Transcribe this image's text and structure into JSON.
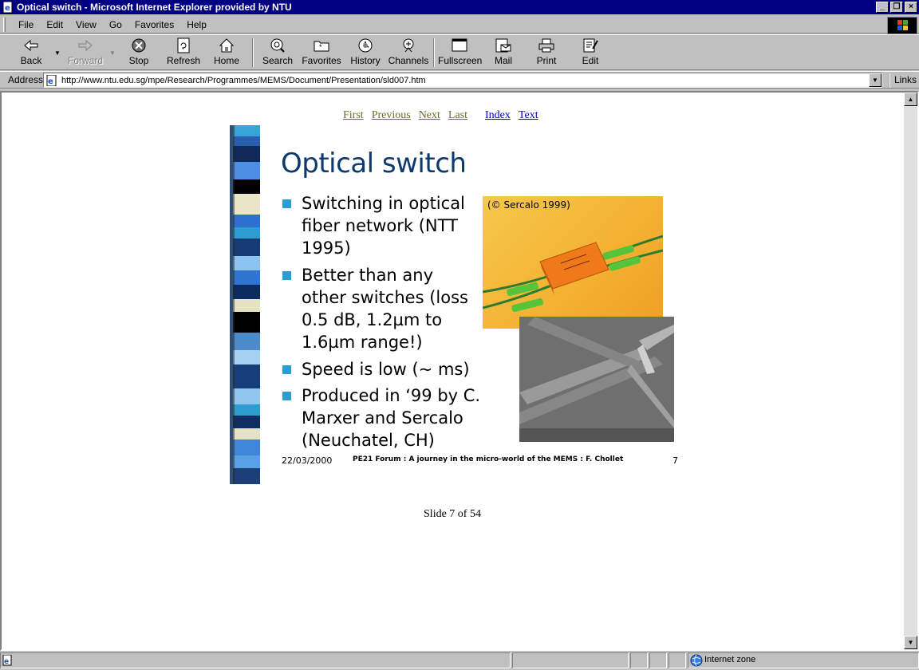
{
  "window": {
    "title": "Optical switch - Microsoft Internet Explorer provided by NTU",
    "controls": [
      "_",
      "Г",
      "×"
    ]
  },
  "menu": [
    "File",
    "Edit",
    "View",
    "Go",
    "Favorites",
    "Help"
  ],
  "toolbar": {
    "back": "Back",
    "forward": "Forward",
    "stop": "Stop",
    "refresh": "Refresh",
    "home": "Home",
    "search": "Search",
    "favorites": "Favorites",
    "history": "History",
    "channels": "Channels",
    "fullscreen": "Fullscreen",
    "mail": "Mail",
    "print": "Print",
    "edit": "Edit"
  },
  "address": {
    "label": "Address",
    "url": "http://www.ntu.edu.sg/mpe/Research/Programmes/MEMS/Document/Presentation/sld007.htm",
    "links_label": "Links"
  },
  "nav": {
    "first": "First",
    "previous": "Previous",
    "next": "Next",
    "last": "Last",
    "index": "Index",
    "text": "Text"
  },
  "slide": {
    "title": "Optical switch",
    "bullets": [
      "Switching in optical\nfiber network (NTT\n1995)",
      "Better than any\nother switches (loss\n0.5 dB, 1.2µm to\n1.6µm range!)",
      "Speed is low (~ ms)",
      "Produced in ‘99 by C.\nMarxer and Sercalo\n(Neuchatel, CH)"
    ],
    "photo_caption": "(© Sercalo 1999)",
    "footer_date": "22/03/2000",
    "footer_center": "PE21 Forum : A journey in the micro-world of the MEMS : F. Chollet",
    "footer_number": "7",
    "accent_color": "#2d9dcf",
    "title_color": "#0c3a6e"
  },
  "slide_counter": "Slide 7 of 54",
  "status": {
    "zone": "Internet zone"
  }
}
